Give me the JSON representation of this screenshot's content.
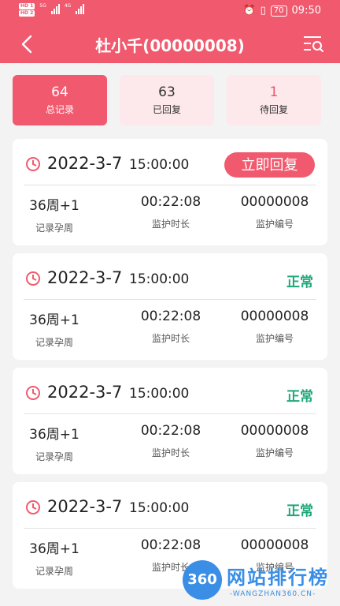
{
  "status_bar": {
    "sim1": "HD 1",
    "sim2": "HD 2",
    "net1": "5G",
    "net2": "4G",
    "battery": "70",
    "time": "09:50"
  },
  "header": {
    "title": "杜小千(00000008)"
  },
  "tabs": [
    {
      "count": "64",
      "label": "总记录",
      "active": true
    },
    {
      "count": "63",
      "label": "已回复",
      "active": false
    },
    {
      "count": "1",
      "label": "待回复",
      "active": false
    }
  ],
  "records": [
    {
      "date": "2022-3-7",
      "time": "15:00:00",
      "action": "立即回复",
      "week": "36周+1",
      "week_label": "记录孕周",
      "duration": "00:22:08",
      "duration_label": "监护时长",
      "number": "00000008",
      "number_label": "监护编号"
    },
    {
      "date": "2022-3-7",
      "time": "15:00:00",
      "status": "正常",
      "week": "36周+1",
      "week_label": "记录孕周",
      "duration": "00:22:08",
      "duration_label": "监护时长",
      "number": "00000008",
      "number_label": "监护编号"
    },
    {
      "date": "2022-3-7",
      "time": "15:00:00",
      "status": "正常",
      "week": "36周+1",
      "week_label": "记录孕周",
      "duration": "00:22:08",
      "duration_label": "监护时长",
      "number": "00000008",
      "number_label": "监护编号"
    },
    {
      "date": "2022-3-7",
      "time": "15:00:00",
      "status": "正常",
      "week": "36周+1",
      "week_label": "记录孕周",
      "duration": "00:22:08",
      "duration_label": "监护时长",
      "number": "00000008",
      "number_label": "监护编号"
    }
  ],
  "watermark": {
    "logo": "360",
    "text": "网站排行榜",
    "sub": "-WANGZHAN360.CN-"
  },
  "colors": {
    "primary": "#f15a6e",
    "tab_inactive_bg": "#fde9ec",
    "status_normal": "#1ea878",
    "background": "#f3f3f3"
  }
}
